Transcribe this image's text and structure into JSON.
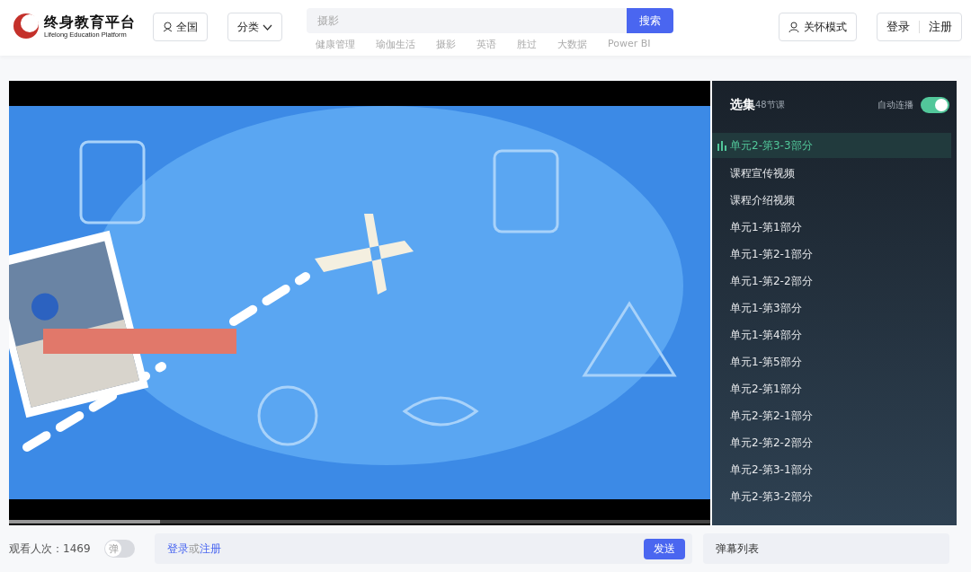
{
  "header": {
    "logo_title": "终身教育平台",
    "logo_subtitle": "Lifelong Education Platform",
    "region_button": "全国",
    "category_button": "分类",
    "search": {
      "placeholder": "摄影",
      "button": "搜索"
    },
    "hot_words": [
      "健康管理",
      "瑜伽生活",
      "摄影",
      "英语",
      "胜过",
      "大数据",
      "Power BI"
    ],
    "care_button": "关怀模式",
    "login": "登录",
    "register": "注册"
  },
  "player": {
    "kind": "picture",
    "progress": {
      "level": 0.215
    }
  },
  "playlist": {
    "title": "选集",
    "count": "48节课",
    "autoplay_label": "自动连播",
    "autoplay_on": true,
    "items": [
      {
        "label": "单元2-第3-3部分",
        "selected": true
      },
      {
        "label": "课程宣传视频",
        "selected": false
      },
      {
        "label": "课程介绍视频",
        "selected": false
      },
      {
        "label": "单元1-第1部分",
        "selected": false
      },
      {
        "label": "单元1-第2-1部分",
        "selected": false
      },
      {
        "label": "单元1-第2-2部分",
        "selected": false
      },
      {
        "label": "单元1-第3部分",
        "selected": false
      },
      {
        "label": "单元1-第4部分",
        "selected": false
      },
      {
        "label": "单元1-第5部分",
        "selected": false
      },
      {
        "label": "单元2-第1部分",
        "selected": false
      },
      {
        "label": "单元2-第2-1部分",
        "selected": false
      },
      {
        "label": "单元2-第2-2部分",
        "selected": false
      },
      {
        "label": "单元2-第3-1部分",
        "selected": false
      },
      {
        "label": "单元2-第3-2部分",
        "selected": false
      }
    ]
  },
  "footer": {
    "views_label": "观看人次：",
    "views": "1469",
    "danmaku_toggle": {
      "label": "弹",
      "on": false
    },
    "comment": {
      "login_link": "登录",
      "or": "或",
      "register_link": "注册",
      "send": "发送"
    },
    "danmaku_list": "弹幕列表"
  }
}
